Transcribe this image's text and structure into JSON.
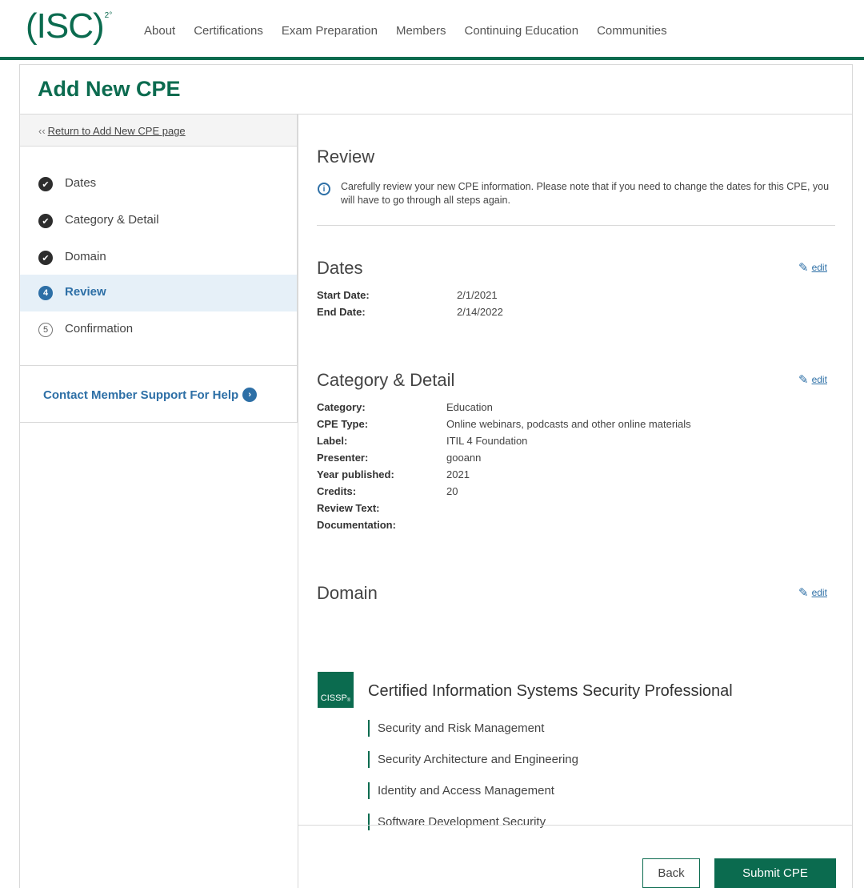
{
  "header": {
    "logo_text": "(ISC)",
    "logo_sup": "2°",
    "nav": [
      "About",
      "Certifications",
      "Exam Preparation",
      "Members",
      "Continuing Education",
      "Communities"
    ],
    "accent_color": "#0b6b4f"
  },
  "page": {
    "title": "Add New CPE"
  },
  "sidebar": {
    "return_link": {
      "prefix": "‹‹",
      "label": "Return to Add New CPE page"
    },
    "steps": [
      {
        "label": "Dates",
        "state": "done",
        "marker": "✔"
      },
      {
        "label": "Category & Detail",
        "state": "done",
        "marker": "✔"
      },
      {
        "label": "Domain",
        "state": "done",
        "marker": "✔"
      },
      {
        "label": "Review",
        "state": "current",
        "marker": "4"
      },
      {
        "label": "Confirmation",
        "state": "pending",
        "marker": "5"
      }
    ],
    "support": {
      "label": "Contact Member Support For Help",
      "arrow": "›"
    }
  },
  "review": {
    "title": "Review",
    "info_icon": "info-icon",
    "info_text": "Carefully review your new CPE information. Please note that if you need to change the dates for this CPE, you will have to go through all steps again."
  },
  "edit_label": "edit",
  "dates": {
    "title": "Dates",
    "fields": [
      {
        "key": "Start Date:",
        "value": "2/1/2021"
      },
      {
        "key": "End Date:",
        "value": "2/14/2022"
      }
    ]
  },
  "category": {
    "title": "Category & Detail",
    "fields": [
      {
        "key": "Category:",
        "value": "Education"
      },
      {
        "key": "CPE Type:",
        "value": "Online webinars, podcasts and other online materials"
      },
      {
        "key": "Label:",
        "value": "ITIL 4 Foundation"
      },
      {
        "key": "Presenter:",
        "value": "gooann"
      },
      {
        "key": "Year published:",
        "value": "2021"
      },
      {
        "key": "Credits:",
        "value": "20"
      },
      {
        "key": "Review Text:",
        "value": ""
      },
      {
        "key": "Documentation:",
        "value": ""
      }
    ]
  },
  "domain": {
    "title": "Domain",
    "badge": "CISSP",
    "badge_sup": "®",
    "certification": "Certified Information Systems Security Professional",
    "items": [
      "Security and Risk Management",
      "Security Architecture and Engineering",
      "Identity and Access Management",
      "Software Development Security"
    ]
  },
  "actions": {
    "back": "Back",
    "submit": "Submit CPE"
  }
}
